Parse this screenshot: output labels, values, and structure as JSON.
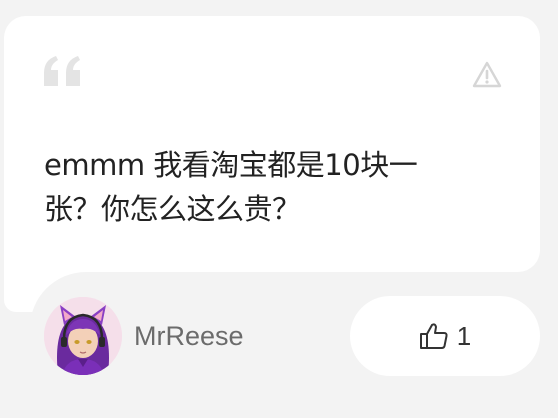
{
  "comment": {
    "text": "emmm 我看淘宝都是10块一张？你怎么这么贵？"
  },
  "author": {
    "name": "MrReese"
  },
  "like": {
    "count": "1"
  },
  "icons": {
    "quote": "quote-icon",
    "report": "warning-icon",
    "like": "thumbs-up-icon",
    "avatar": "purple-haired-cat-ear-character"
  },
  "colors": {
    "background": "#f3f3f3",
    "card": "#ffffff",
    "text": "#222222",
    "muted": "#6b6b6b",
    "icon": "#e0e0e0"
  }
}
